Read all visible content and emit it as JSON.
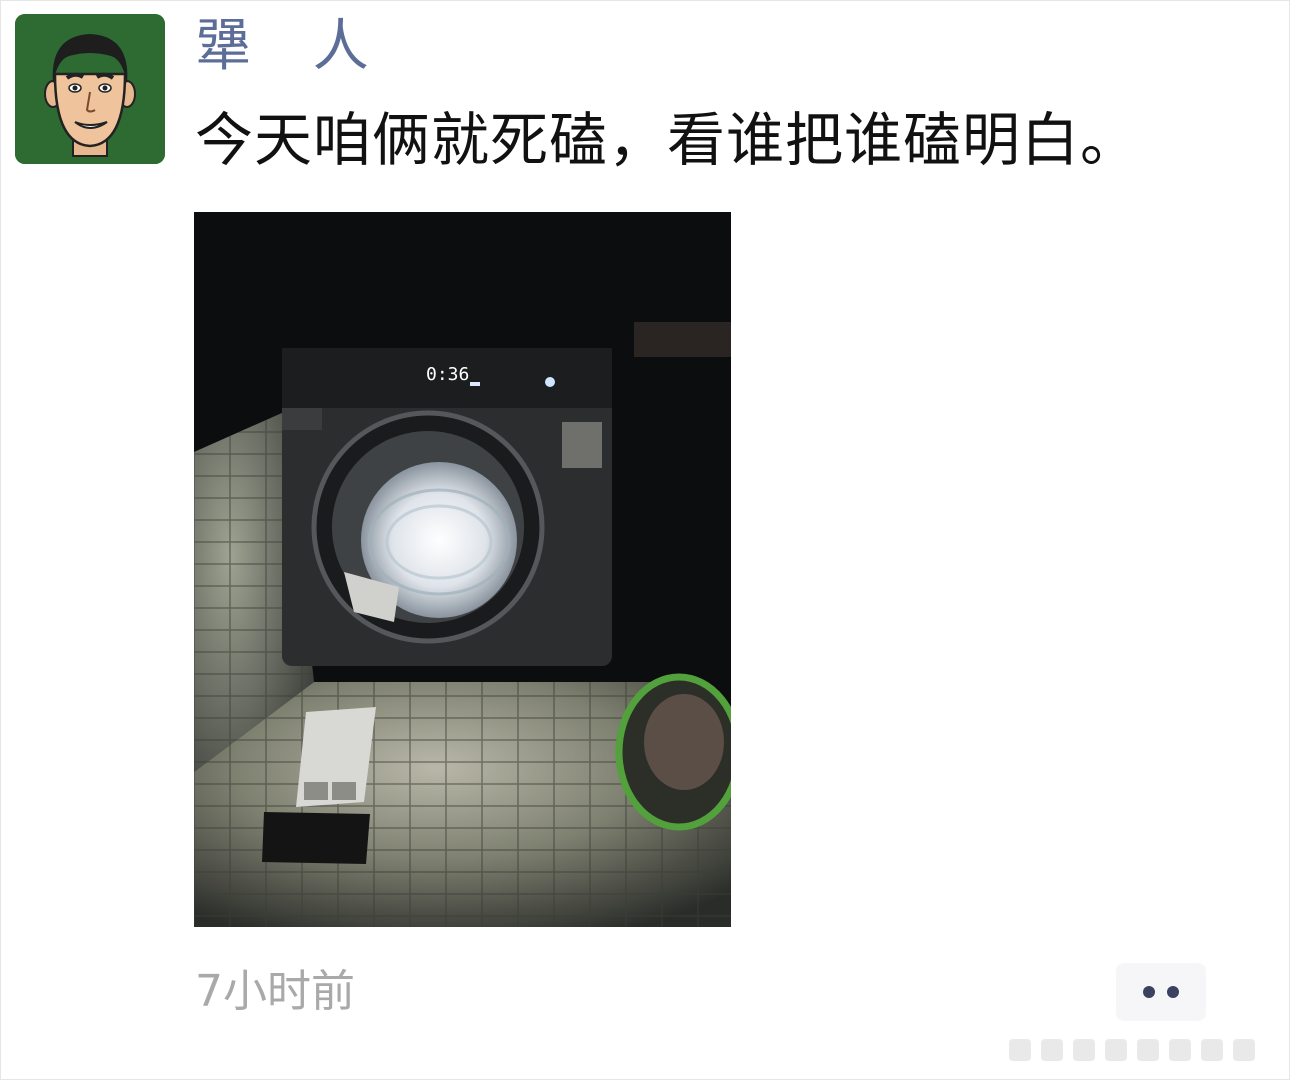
{
  "post": {
    "author_name": "犟 人",
    "text": "今天咱俩就死磕，看谁把谁磕明白。",
    "timestamp": "7小时前",
    "avatar_icon": "cartoon-man-avatar",
    "more_icon": "two-dots-more-icon"
  },
  "colors": {
    "author_name": "#5c6d98",
    "avatar_bg": "#2d6b32",
    "timestamp": "#a9a9a9",
    "more_button_bg": "#f6f6f8"
  }
}
